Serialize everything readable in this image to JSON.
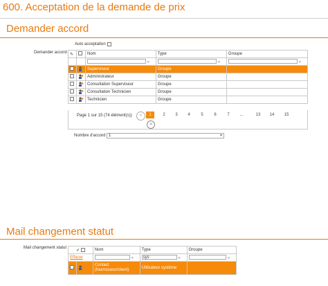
{
  "page_title": "600. Acceptation de la demande de prix",
  "section1": {
    "title": "Demander accord",
    "field_label": "Demander accord",
    "auto_label": "Auto acceptation",
    "headers": [
      "Nom",
      "Type",
      "Groupe"
    ],
    "rows": [
      {
        "name": "Superviseur",
        "type": "Groupe",
        "group": "",
        "selected": true
      },
      {
        "name": "Administrateur",
        "type": "Groupe",
        "group": ""
      },
      {
        "name": "Consultation Superviseur",
        "type": "Groupe",
        "group": ""
      },
      {
        "name": "Consultation Technicien",
        "type": "Groupe",
        "group": ""
      },
      {
        "name": "Technicien",
        "type": "Groupe",
        "group": ""
      }
    ],
    "pager_info": "Page 1 sur 15 (74 élément(s))",
    "pages": [
      "1",
      "2",
      "3",
      "4",
      "5",
      "6",
      "7",
      "...",
      "13",
      "14",
      "15"
    ],
    "prev": "<",
    "next": ">",
    "count_label": "Nombre d'accord",
    "count_value": "1"
  },
  "section2": {
    "title": "Mail changement statut",
    "field_label": "Mail changement statut",
    "clear_link": "Effacer",
    "headers": [
      "Nom",
      "Type",
      "Groupe"
    ],
    "filter_type": "sys",
    "rows": [
      {
        "name": "Contact\n(fournisseur/client)",
        "type": "Utilisateur système",
        "group": "",
        "selected": true
      }
    ]
  },
  "colors": {
    "accent": "#f58a0b",
    "title": "#e87a11"
  }
}
